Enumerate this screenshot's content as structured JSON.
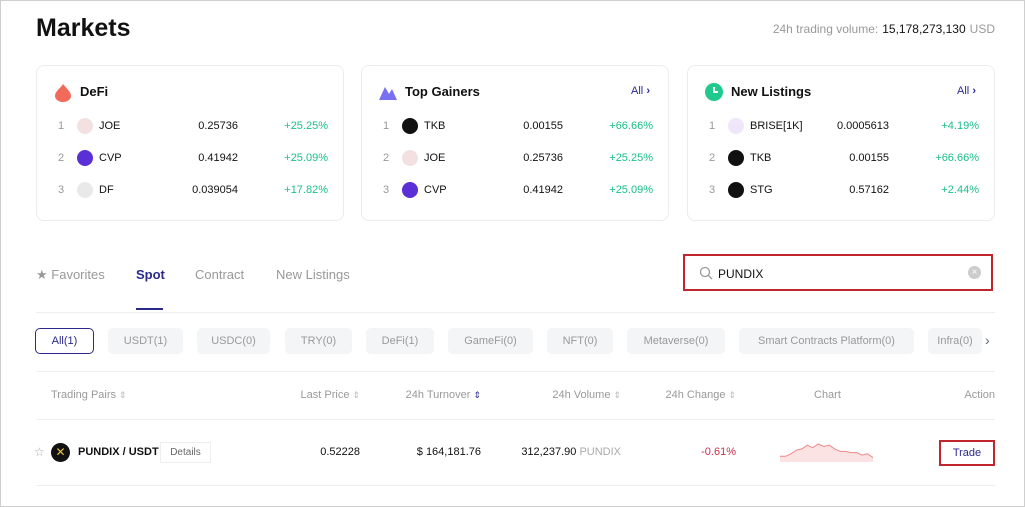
{
  "header": {
    "title": "Markets",
    "volume_label": "24h trading volume:",
    "volume_value": "15,178,273,130",
    "volume_unit": "USD"
  },
  "cards": [
    {
      "title": "DeFi",
      "icon": "flame-icon",
      "all": "",
      "rows": [
        {
          "rank": "1",
          "symbol": "JOE",
          "price": "0.25736",
          "change": "+25.25%",
          "color": "#f3e1e1"
        },
        {
          "rank": "2",
          "symbol": "CVP",
          "price": "0.41942",
          "change": "+25.09%",
          "color": "#5a2fd6"
        },
        {
          "rank": "3",
          "symbol": "DF",
          "price": "0.039054",
          "change": "+17.82%",
          "color": "#e9e9e9"
        }
      ]
    },
    {
      "title": "Top Gainers",
      "icon": "mountain-icon",
      "all": "All",
      "rows": [
        {
          "rank": "1",
          "symbol": "TKB",
          "price": "0.00155",
          "change": "+66.66%",
          "color": "#111111"
        },
        {
          "rank": "2",
          "symbol": "JOE",
          "price": "0.25736",
          "change": "+25.25%",
          "color": "#f3e1e1"
        },
        {
          "rank": "3",
          "symbol": "CVP",
          "price": "0.41942",
          "change": "+25.09%",
          "color": "#5a2fd6"
        }
      ]
    },
    {
      "title": "New Listings",
      "icon": "clock-icon",
      "all": "All",
      "rows": [
        {
          "rank": "1",
          "symbol": "BRISE[1K]",
          "price": "0.0005613",
          "change": "+4.19%",
          "color": "#f0e6fa"
        },
        {
          "rank": "2",
          "symbol": "TKB",
          "price": "0.00155",
          "change": "+66.66%",
          "color": "#111111"
        },
        {
          "rank": "3",
          "symbol": "STG",
          "price": "0.57162",
          "change": "+2.44%",
          "color": "#111111"
        }
      ]
    }
  ],
  "tabs": [
    "Favorites",
    "Spot",
    "Contract",
    "New Listings"
  ],
  "search": {
    "value": "PUNDIX"
  },
  "filters": [
    "All(1)",
    "USDT(1)",
    "USDC(0)",
    "TRY(0)",
    "DeFi(1)",
    "GameFi(0)",
    "NFT(0)",
    "Metaverse(0)",
    "Smart Contracts Platform(0)",
    "Infra(0)"
  ],
  "table": {
    "headers": [
      "Trading Pairs",
      "Last Price",
      "24h Turnover",
      "24h Volume",
      "24h Change",
      "Chart",
      "Action"
    ],
    "row": {
      "pair": "PUNDIX / USDT",
      "details": "Details",
      "price": "0.52228",
      "turnover": "$ 164,181.76",
      "volume": "312,237.90",
      "volume_unit": "PUNDIX",
      "change": "-0.61%",
      "trade": "Trade",
      "sparkline": [
        3,
        3,
        5,
        8,
        9,
        12,
        10,
        13,
        11,
        12,
        9,
        7,
        7,
        6,
        6,
        4,
        5,
        2
      ]
    }
  },
  "colors": {
    "accent": "#2a2a8a",
    "up": "#1bbf8a",
    "down": "#d0304a",
    "highlight": "#c0272d"
  }
}
